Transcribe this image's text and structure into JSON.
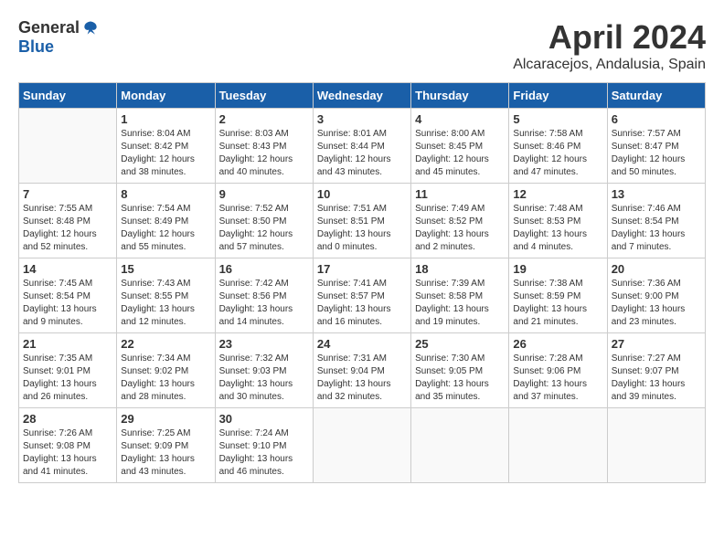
{
  "logo": {
    "general": "General",
    "blue": "Blue"
  },
  "title": "April 2024",
  "location": "Alcaracejos, Andalusia, Spain",
  "days_of_week": [
    "Sunday",
    "Monday",
    "Tuesday",
    "Wednesday",
    "Thursday",
    "Friday",
    "Saturday"
  ],
  "weeks": [
    [
      {
        "day": "",
        "info": ""
      },
      {
        "day": "1",
        "info": "Sunrise: 8:04 AM\nSunset: 8:42 PM\nDaylight: 12 hours\nand 38 minutes."
      },
      {
        "day": "2",
        "info": "Sunrise: 8:03 AM\nSunset: 8:43 PM\nDaylight: 12 hours\nand 40 minutes."
      },
      {
        "day": "3",
        "info": "Sunrise: 8:01 AM\nSunset: 8:44 PM\nDaylight: 12 hours\nand 43 minutes."
      },
      {
        "day": "4",
        "info": "Sunrise: 8:00 AM\nSunset: 8:45 PM\nDaylight: 12 hours\nand 45 minutes."
      },
      {
        "day": "5",
        "info": "Sunrise: 7:58 AM\nSunset: 8:46 PM\nDaylight: 12 hours\nand 47 minutes."
      },
      {
        "day": "6",
        "info": "Sunrise: 7:57 AM\nSunset: 8:47 PM\nDaylight: 12 hours\nand 50 minutes."
      }
    ],
    [
      {
        "day": "7",
        "info": "Sunrise: 7:55 AM\nSunset: 8:48 PM\nDaylight: 12 hours\nand 52 minutes."
      },
      {
        "day": "8",
        "info": "Sunrise: 7:54 AM\nSunset: 8:49 PM\nDaylight: 12 hours\nand 55 minutes."
      },
      {
        "day": "9",
        "info": "Sunrise: 7:52 AM\nSunset: 8:50 PM\nDaylight: 12 hours\nand 57 minutes."
      },
      {
        "day": "10",
        "info": "Sunrise: 7:51 AM\nSunset: 8:51 PM\nDaylight: 13 hours\nand 0 minutes."
      },
      {
        "day": "11",
        "info": "Sunrise: 7:49 AM\nSunset: 8:52 PM\nDaylight: 13 hours\nand 2 minutes."
      },
      {
        "day": "12",
        "info": "Sunrise: 7:48 AM\nSunset: 8:53 PM\nDaylight: 13 hours\nand 4 minutes."
      },
      {
        "day": "13",
        "info": "Sunrise: 7:46 AM\nSunset: 8:54 PM\nDaylight: 13 hours\nand 7 minutes."
      }
    ],
    [
      {
        "day": "14",
        "info": "Sunrise: 7:45 AM\nSunset: 8:54 PM\nDaylight: 13 hours\nand 9 minutes."
      },
      {
        "day": "15",
        "info": "Sunrise: 7:43 AM\nSunset: 8:55 PM\nDaylight: 13 hours\nand 12 minutes."
      },
      {
        "day": "16",
        "info": "Sunrise: 7:42 AM\nSunset: 8:56 PM\nDaylight: 13 hours\nand 14 minutes."
      },
      {
        "day": "17",
        "info": "Sunrise: 7:41 AM\nSunset: 8:57 PM\nDaylight: 13 hours\nand 16 minutes."
      },
      {
        "day": "18",
        "info": "Sunrise: 7:39 AM\nSunset: 8:58 PM\nDaylight: 13 hours\nand 19 minutes."
      },
      {
        "day": "19",
        "info": "Sunrise: 7:38 AM\nSunset: 8:59 PM\nDaylight: 13 hours\nand 21 minutes."
      },
      {
        "day": "20",
        "info": "Sunrise: 7:36 AM\nSunset: 9:00 PM\nDaylight: 13 hours\nand 23 minutes."
      }
    ],
    [
      {
        "day": "21",
        "info": "Sunrise: 7:35 AM\nSunset: 9:01 PM\nDaylight: 13 hours\nand 26 minutes."
      },
      {
        "day": "22",
        "info": "Sunrise: 7:34 AM\nSunset: 9:02 PM\nDaylight: 13 hours\nand 28 minutes."
      },
      {
        "day": "23",
        "info": "Sunrise: 7:32 AM\nSunset: 9:03 PM\nDaylight: 13 hours\nand 30 minutes."
      },
      {
        "day": "24",
        "info": "Sunrise: 7:31 AM\nSunset: 9:04 PM\nDaylight: 13 hours\nand 32 minutes."
      },
      {
        "day": "25",
        "info": "Sunrise: 7:30 AM\nSunset: 9:05 PM\nDaylight: 13 hours\nand 35 minutes."
      },
      {
        "day": "26",
        "info": "Sunrise: 7:28 AM\nSunset: 9:06 PM\nDaylight: 13 hours\nand 37 minutes."
      },
      {
        "day": "27",
        "info": "Sunrise: 7:27 AM\nSunset: 9:07 PM\nDaylight: 13 hours\nand 39 minutes."
      }
    ],
    [
      {
        "day": "28",
        "info": "Sunrise: 7:26 AM\nSunset: 9:08 PM\nDaylight: 13 hours\nand 41 minutes."
      },
      {
        "day": "29",
        "info": "Sunrise: 7:25 AM\nSunset: 9:09 PM\nDaylight: 13 hours\nand 43 minutes."
      },
      {
        "day": "30",
        "info": "Sunrise: 7:24 AM\nSunset: 9:10 PM\nDaylight: 13 hours\nand 46 minutes."
      },
      {
        "day": "",
        "info": ""
      },
      {
        "day": "",
        "info": ""
      },
      {
        "day": "",
        "info": ""
      },
      {
        "day": "",
        "info": ""
      }
    ]
  ]
}
